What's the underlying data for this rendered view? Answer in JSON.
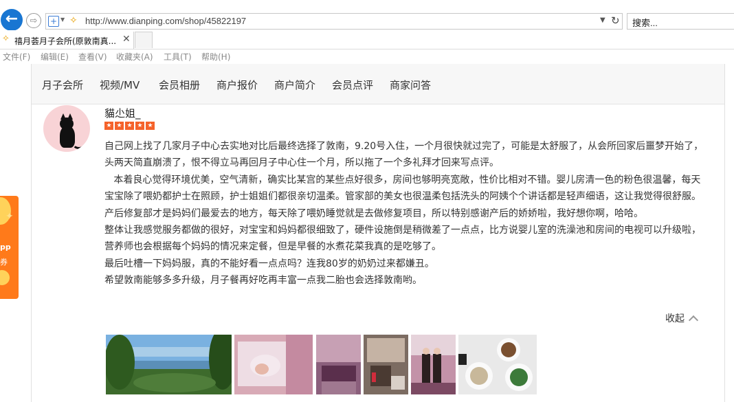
{
  "browser": {
    "url": "http://www.dianping.com/shop/45822197",
    "search_placeholder": "搜索...",
    "tab_title": "禧月荟月子会所(原敦南真..."
  },
  "menu": [
    "文件(F)",
    "编辑(E)",
    "查看(V)",
    "收藏夹(A)",
    "工具(T)",
    "帮助(H)"
  ],
  "promo": {
    "line1": "pp",
    "line2": "券"
  },
  "subnav": [
    "月子会所",
    "视频/MV",
    "会员相册",
    "商户报价",
    "商户简介",
    "会员点评",
    "商家问答"
  ],
  "review": {
    "username": "貓尐姐_",
    "rating": 5,
    "paragraphs": [
      "自己网上找了几家月子中心去实地对比后最终选择了敦南，9.20号入住，一个月很快就过完了，可能是太舒服了，从会所回家后噩梦开始了，头两天简直崩溃了，恨不得立马再回月子中心住一个月，所以拖了一个多礼拜才回来写点评。",
      "   本着良心觉得环境优美，空气清新，确实比某宫的某些点好很多，房间也够明亮宽敞，性价比相对不错。婴儿房清一色的粉色很温馨，每天宝宝除了喂奶都护士在照顾，护士姐姐们都很亲切温柔。管家部的美女也很温柔包括洗头的阿姨个个讲话都是轻声细语，这让我觉得很舒服。产后修复部才是妈妈们最爱去的地方，每天除了喂奶睡觉就是去做修复项目，所以特别感谢产后的娇娇啦，我好想你啊，哈哈。",
      "整体让我感觉服务都做的很好，对宝宝和妈妈都很细致了，硬件设施倒是稍微差了一点点，比方说婴儿室的洗澡池和房间的电视可以升级啦，营养师也会根据每个妈妈的情况来定餐，但是早餐的水煮花菜我真的是吃够了。",
      "最后吐槽一下妈妈服，真的不能好看一点点吗？连我80岁的奶奶过来都嫌丑。",
      "希望敦南能够多多升级，月子餐再好吃再丰富一点我二胎也会选择敦南哟。"
    ],
    "collapse_label": "收起"
  },
  "photos": [
    {
      "name": "lake-landscape-photo",
      "colors": [
        "#6fa6d8",
        "#2f5a24",
        "#3b6f33"
      ]
    },
    {
      "name": "baby-photo",
      "colors": [
        "#d9a9b4",
        "#f0e4ea",
        "#b07b8c"
      ]
    },
    {
      "name": "room-photo-1",
      "colors": [
        "#8a5a7a",
        "#c9a2b8",
        "#5b3a4e"
      ]
    },
    {
      "name": "room-photo-2",
      "colors": [
        "#7a6a60",
        "#b9a79a",
        "#4a3a32"
      ]
    },
    {
      "name": "staff-photo",
      "colors": [
        "#b07a90",
        "#3a2a2a",
        "#e3cfd6"
      ]
    },
    {
      "name": "meal-photo",
      "colors": [
        "#f2f2f2",
        "#6a4a2a",
        "#2a6a2a"
      ]
    }
  ]
}
